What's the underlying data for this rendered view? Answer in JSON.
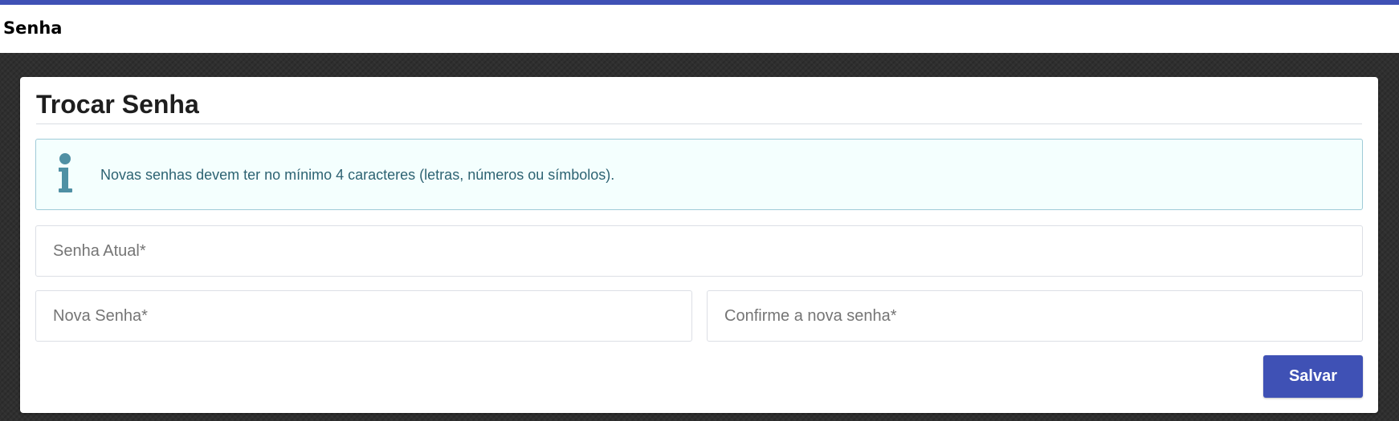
{
  "header": {
    "title": "Senha"
  },
  "card": {
    "title": "Trocar Senha",
    "info": {
      "icon": "info-icon",
      "message": "Novas senhas devem ter no mínimo 4 caracteres (letras, números ou símbolos)."
    },
    "fields": {
      "current_password": {
        "placeholder": "Senha Atual*",
        "value": ""
      },
      "new_password": {
        "placeholder": "Nova Senha*",
        "value": ""
      },
      "confirm_password": {
        "placeholder": "Confirme a nova senha*",
        "value": ""
      }
    },
    "save_label": "Salvar"
  },
  "colors": {
    "accent": "#3f51b5",
    "info_background": "#f4fffe",
    "info_border": "#9fcbd8",
    "info_text": "#2d6272",
    "info_icon": "#4f90a4"
  }
}
